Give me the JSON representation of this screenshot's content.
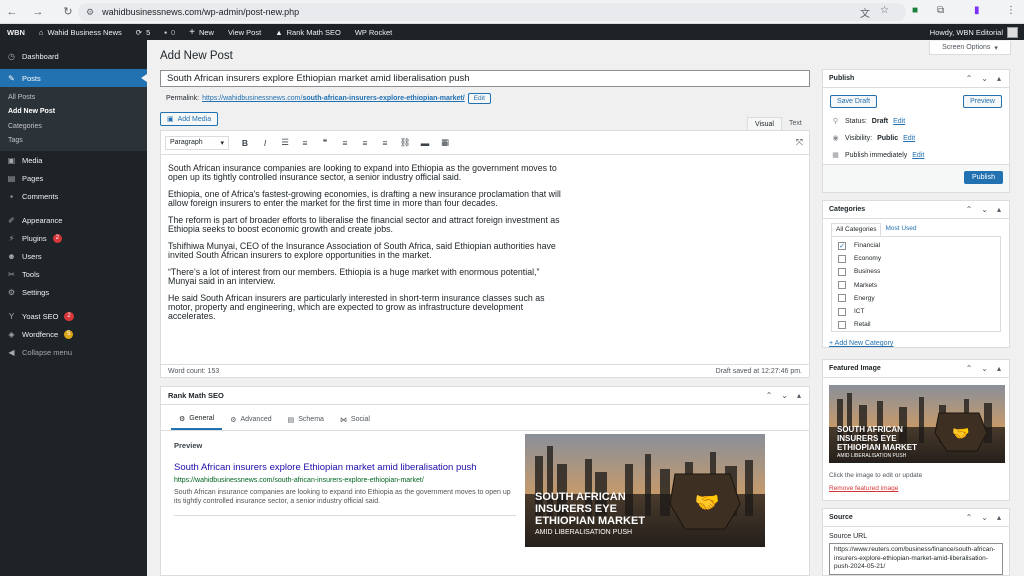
{
  "browser": {
    "url": "wahidbusinessnews.com/wp-admin/post-new.php",
    "back_icon": "arrow-left-icon",
    "forward_icon": "arrow-right-icon",
    "reload_icon": "reload-icon"
  },
  "adminbar": {
    "site_short": "WBN",
    "site_name": "Wahid Business News",
    "updates_count": "5",
    "comments_count": "0",
    "new_label": "New",
    "view_post": "View Post",
    "rank_math": "Rank Math SEO",
    "wp_rocket": "WP Rocket",
    "howdy": "Howdy, WBN Editorial"
  },
  "sidebar": {
    "dashboard": "Dashboard",
    "posts": "Posts",
    "posts_sub": [
      "All Posts",
      "Add New Post",
      "Categories",
      "Tags"
    ],
    "media": "Media",
    "pages": "Pages",
    "comments": "Comments",
    "appearance": "Appearance",
    "plugins": "Plugins",
    "plugins_badge": "2",
    "users": "Users",
    "tools": "Tools",
    "settings": "Settings",
    "yoast": "Yoast SEO",
    "yoast_badge": "2",
    "wordfence": "Wordfence",
    "wordfence_badge": "5",
    "collapse": "Collapse menu"
  },
  "editor": {
    "screen_options": "Screen Options",
    "page_title": "Add New Post",
    "post_title": "South African insurers explore Ethiopian market amid liberalisation push",
    "permalink_label": "Permalink:",
    "permalink_base": "https://wahidbusinessnews.com/",
    "permalink_slug": "south-african-insurers-explore-ethiopian-market/",
    "edit_label": "Edit",
    "add_media": "Add Media",
    "tab_visual": "Visual",
    "tab_text": "Text",
    "format_select": "Paragraph",
    "paragraphs": [
      "South African insurance companies are looking to expand into Ethiopia as the government moves to open up its tightly controlled insurance sector, a senior industry official said.",
      "Ethiopia, one of Africa's fastest-growing economies, is drafting a new insurance proclamation that will allow foreign insurers to enter the market for the first time in more than four decades.",
      "The reform is part of broader efforts to liberalise the financial sector and attract foreign investment as Ethiopia seeks to boost economic growth and create jobs.",
      "Tshifhiwa Munyai, CEO of the Insurance Association of South Africa, said Ethiopian authorities have invited South African insurers to explore opportunities in the market.",
      "“There’s a lot of interest from our members. Ethiopia is a huge market with enormous potential,” Munyai said in an interview.",
      "He said South African insurers are particularly interested in short-term insurance classes such as motor, property and engineering, which are expected to grow as infrastructure development accelerates."
    ],
    "word_count": "Word count: 153",
    "draft_saved": "Draft saved at 12:27:46 pm."
  },
  "rankmath": {
    "title": "Rank Math SEO",
    "tabs": [
      "General",
      "Advanced",
      "Schema",
      "Social"
    ],
    "preview_label": "Preview",
    "serp_title": "South African insurers explore Ethiopian market amid liberalisation push",
    "serp_url": "https://wahidbusinessnews.com/south-african-insurers-explore-ethiopian-market/",
    "serp_desc": "South African insurance companies are looking to expand into Ethiopia as the government moves to open up its tightly controlled insurance sector, a senior industry official said."
  },
  "publish": {
    "title": "Publish",
    "save_draft": "Save Draft",
    "preview": "Preview",
    "status_label": "Status:",
    "status_value": "Draft",
    "visibility_label": "Visibility:",
    "visibility_value": "Public",
    "publish_when": "Publish immediately",
    "edit": "Edit",
    "publish_button": "Publish"
  },
  "categories": {
    "title": "Categories",
    "tab_all": "All Categories",
    "tab_used": "Most Used",
    "items": [
      "Financial",
      "Economy",
      "Business",
      "Markets",
      "Energy",
      "ICT",
      "Retail"
    ],
    "add_new": "+ Add New Category"
  },
  "featured": {
    "title": "Featured Image",
    "hint": "Click the image to edit or update",
    "remove": "Remove featured image"
  },
  "image_text": {
    "line1": "SOUTH AFRICAN",
    "line2": "INSURERS EYE",
    "line3": "ETHIOPIAN MARKET",
    "line4": "AMID LIBERALISATION PUSH"
  },
  "source": {
    "title": "Source",
    "label": "Source URL",
    "value": "https://www.reuters.com/business/finance/south-african-insurers-explore-ethiopian-market-amid-liberalisation-push-2024-05-21/"
  },
  "colors": {
    "admin_dark": "#1d2327",
    "accent": "#2271b1",
    "danger": "#d63638"
  }
}
